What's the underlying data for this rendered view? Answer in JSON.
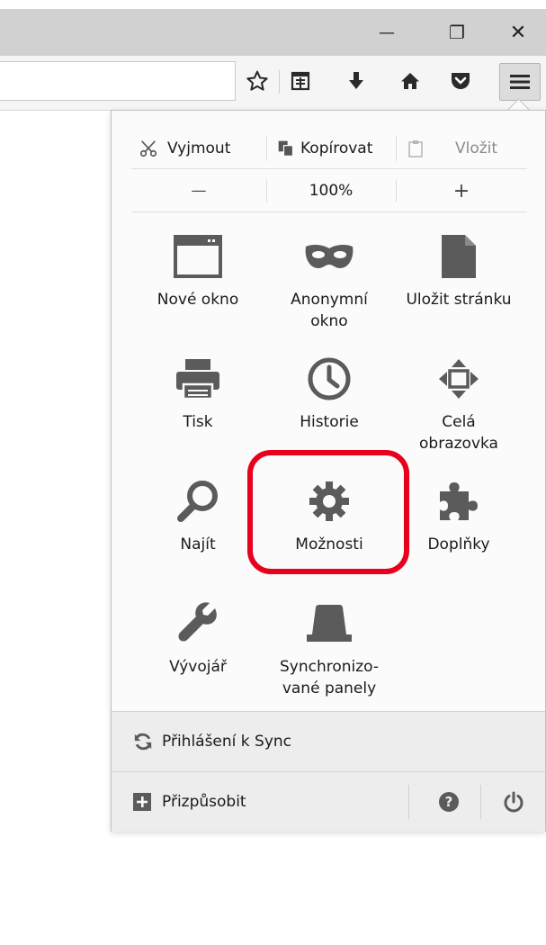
{
  "window": {
    "minimize_glyph": "—",
    "restore_glyph": "❐",
    "close_glyph": "✕"
  },
  "toolbar": {
    "icons": [
      "star-icon",
      "reading-list-icon",
      "download-icon",
      "home-icon",
      "pocket-icon",
      "hamburger-menu-icon"
    ]
  },
  "menu": {
    "edit": {
      "cut": "Vyjmout",
      "copy": "Kopírovat",
      "paste": "Vložit"
    },
    "zoom": {
      "minus": "—",
      "level": "100%",
      "plus": "+"
    },
    "items": [
      {
        "label": "Nové okno",
        "icon": "new-window-icon"
      },
      {
        "label": "Anonymní okno",
        "icon": "private-mask-icon"
      },
      {
        "label": "Uložit stránku",
        "icon": "save-page-icon"
      },
      {
        "label": "Tisk",
        "icon": "print-icon"
      },
      {
        "label": "Historie",
        "icon": "history-clock-icon"
      },
      {
        "label": "Celá obrazovka",
        "icon": "fullscreen-icon"
      },
      {
        "label": "Najít",
        "icon": "magnifier-icon"
      },
      {
        "label": "Možnosti",
        "icon": "gear-icon"
      },
      {
        "label": "Doplňky",
        "icon": "puzzle-icon"
      },
      {
        "label": "Vývojář",
        "icon": "wrench-icon"
      },
      {
        "label": "Synchronizo-vané panely",
        "icon": "synced-tabs-icon"
      }
    ],
    "sync_label": "Přihlášení k Sync",
    "customize_label": "Přizpůsobit",
    "help_glyph": "?"
  },
  "colors": {
    "icon_gray": "#5b5b5b",
    "highlight_red": "#e8001c",
    "titlebar": "#d1d1d1"
  }
}
